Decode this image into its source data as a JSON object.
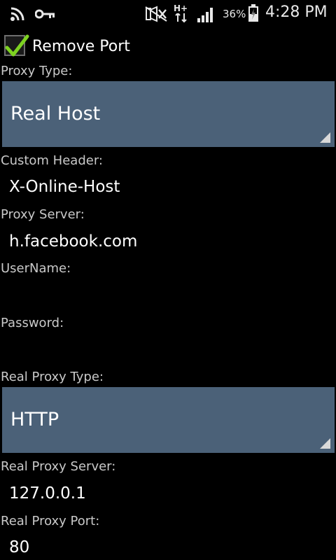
{
  "status_bar": {
    "icons": [
      "rss-icon",
      "key-icon",
      "mute-icon",
      "hplus-data-icon",
      "signal-icon",
      "battery-charging-icon"
    ],
    "network_type": "H+",
    "battery_percent": "36%",
    "time": "4:28 PM"
  },
  "form": {
    "remove_port": {
      "label": "Remove Port",
      "checked": true
    },
    "proxy_type": {
      "label": "Proxy Type:",
      "value": "Real Host"
    },
    "custom_header": {
      "label": "Custom Header:",
      "value": "X-Online-Host"
    },
    "proxy_server": {
      "label": "Proxy Server:",
      "value": "h.facebook.com"
    },
    "username": {
      "label": "UserName:",
      "value": ""
    },
    "password": {
      "label": "Password:",
      "value": ""
    },
    "real_proxy_type": {
      "label": "Real Proxy Type:",
      "value": "HTTP"
    },
    "real_proxy_server": {
      "label": "Real Proxy Server:",
      "value": "127.0.0.1"
    },
    "real_proxy_port": {
      "label": "Real Proxy Port:",
      "value": "80"
    }
  },
  "colors": {
    "background": "#000000",
    "spinner_bg": "#4b6178",
    "check_green": "#7ed321",
    "label_gray": "#c9c9c9"
  }
}
